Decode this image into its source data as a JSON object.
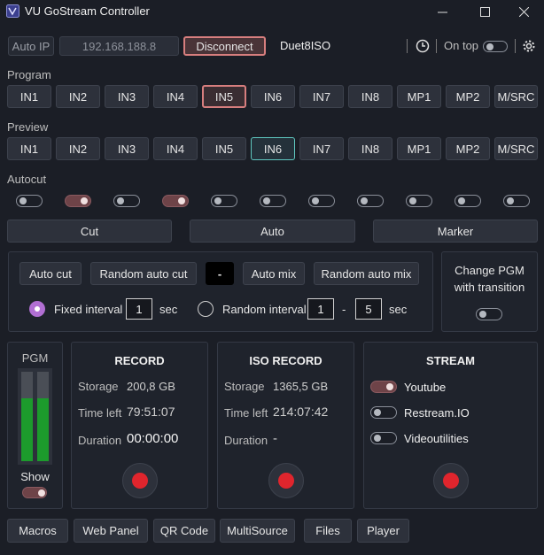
{
  "window": {
    "title": "VU GoStream Controller",
    "minimize": "—",
    "maximize": "☐",
    "close": "✕"
  },
  "connection": {
    "auto_ip_label": "Auto IP",
    "ip_value": "192.168.188.8",
    "disconnect_label": "Disconnect",
    "device_name": "Duet8ISO",
    "on_top_label": "On top"
  },
  "program": {
    "label": "Program",
    "buttons": [
      "IN1",
      "IN2",
      "IN3",
      "IN4",
      "IN5",
      "IN6",
      "IN7",
      "IN8",
      "MP1",
      "MP2",
      "M/SRC"
    ],
    "active": "IN5"
  },
  "preview": {
    "label": "Preview",
    "buttons": [
      "IN1",
      "IN2",
      "IN3",
      "IN4",
      "IN5",
      "IN6",
      "IN7",
      "IN8",
      "MP1",
      "MP2",
      "M/SRC"
    ],
    "active": "IN6"
  },
  "autocut": {
    "label": "Autocut",
    "toggles": [
      false,
      true,
      false,
      true,
      false,
      false,
      false,
      false,
      false,
      false,
      false
    ]
  },
  "transitions": {
    "cut": "Cut",
    "auto": "Auto",
    "marker": "Marker"
  },
  "autocut_panel": {
    "auto_cut": "Auto cut",
    "random_auto_cut": "Random auto cut",
    "dash_display": "-",
    "auto_mix": "Auto mix",
    "random_auto_mix": "Random auto mix",
    "fixed_interval_label": "Fixed interval",
    "fixed_interval_value": "1",
    "sec1": "sec",
    "random_interval_label": "Random interval",
    "random_min": "1",
    "range_dash": "-",
    "random_max": "5",
    "sec2": "sec"
  },
  "change_pgm": {
    "line1": "Change PGM",
    "line2": "with transition"
  },
  "pgm_meter": {
    "label": "PGM",
    "show_label": "Show",
    "level": 0.7
  },
  "record": {
    "title": "RECORD",
    "storage_label": "Storage",
    "storage_value": "200,8 GB",
    "time_left_label": "Time left",
    "time_left_value": "79:51:07",
    "duration_label": "Duration",
    "duration_value": "00:00:00"
  },
  "iso_record": {
    "title": "ISO RECORD",
    "storage_label": "Storage",
    "storage_value": "1365,5 GB",
    "time_left_label": "Time left",
    "time_left_value": "214:07:42",
    "duration_label": "Duration",
    "duration_value": "-"
  },
  "stream": {
    "title": "STREAM",
    "items": [
      {
        "label": "Youtube",
        "on": true
      },
      {
        "label": "Restream.IO",
        "on": false
      },
      {
        "label": "Videoutilities",
        "on": false
      }
    ]
  },
  "bottom": [
    "Macros",
    "Web Panel",
    "QR Code",
    "MultiSource",
    "Files",
    "Player"
  ]
}
